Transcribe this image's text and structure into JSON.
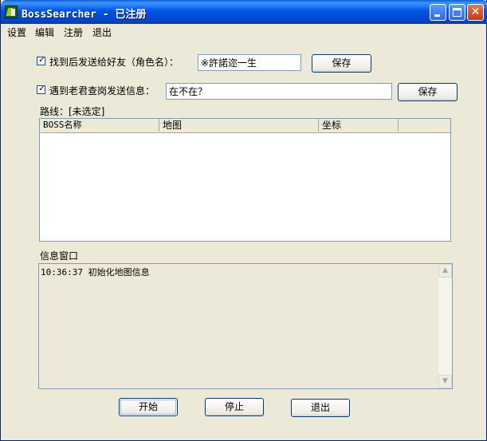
{
  "window": {
    "title": "BossSearcher - 已注册"
  },
  "titlebar": {
    "minimize_icon": "minimize-icon",
    "maximize_icon": "maximize-icon",
    "close_glyph": "✕"
  },
  "menu": {
    "items": [
      "设置",
      "编辑",
      "注册",
      "退出"
    ]
  },
  "friend": {
    "checked": true,
    "check_glyph": "✓",
    "label": "找到后发送给好友（角色名）：",
    "value": "※許諾迩一生",
    "save_label": "保存"
  },
  "message": {
    "checked": true,
    "check_glyph": "✓",
    "label": "遇到老君查岗发送信息：",
    "value": "在不在？",
    "save_label": "保存"
  },
  "route": {
    "label": "路线：[未选定]"
  },
  "list": {
    "columns": [
      "BOSS名称",
      "地图",
      "坐标",
      ""
    ],
    "rows": []
  },
  "log": {
    "label": "信息窗口",
    "lines": [
      "10:36:37 初始化地图信息"
    ],
    "scroll_up_glyph": "▲",
    "scroll_down_glyph": "▼"
  },
  "buttons": {
    "start": "开始",
    "stop": "停止",
    "exit": "退出"
  },
  "colors": {
    "titlebar": "#0055E5",
    "face": "#ECE9D8",
    "button_border": "#003C74",
    "field_border": "#7F9DB9"
  }
}
